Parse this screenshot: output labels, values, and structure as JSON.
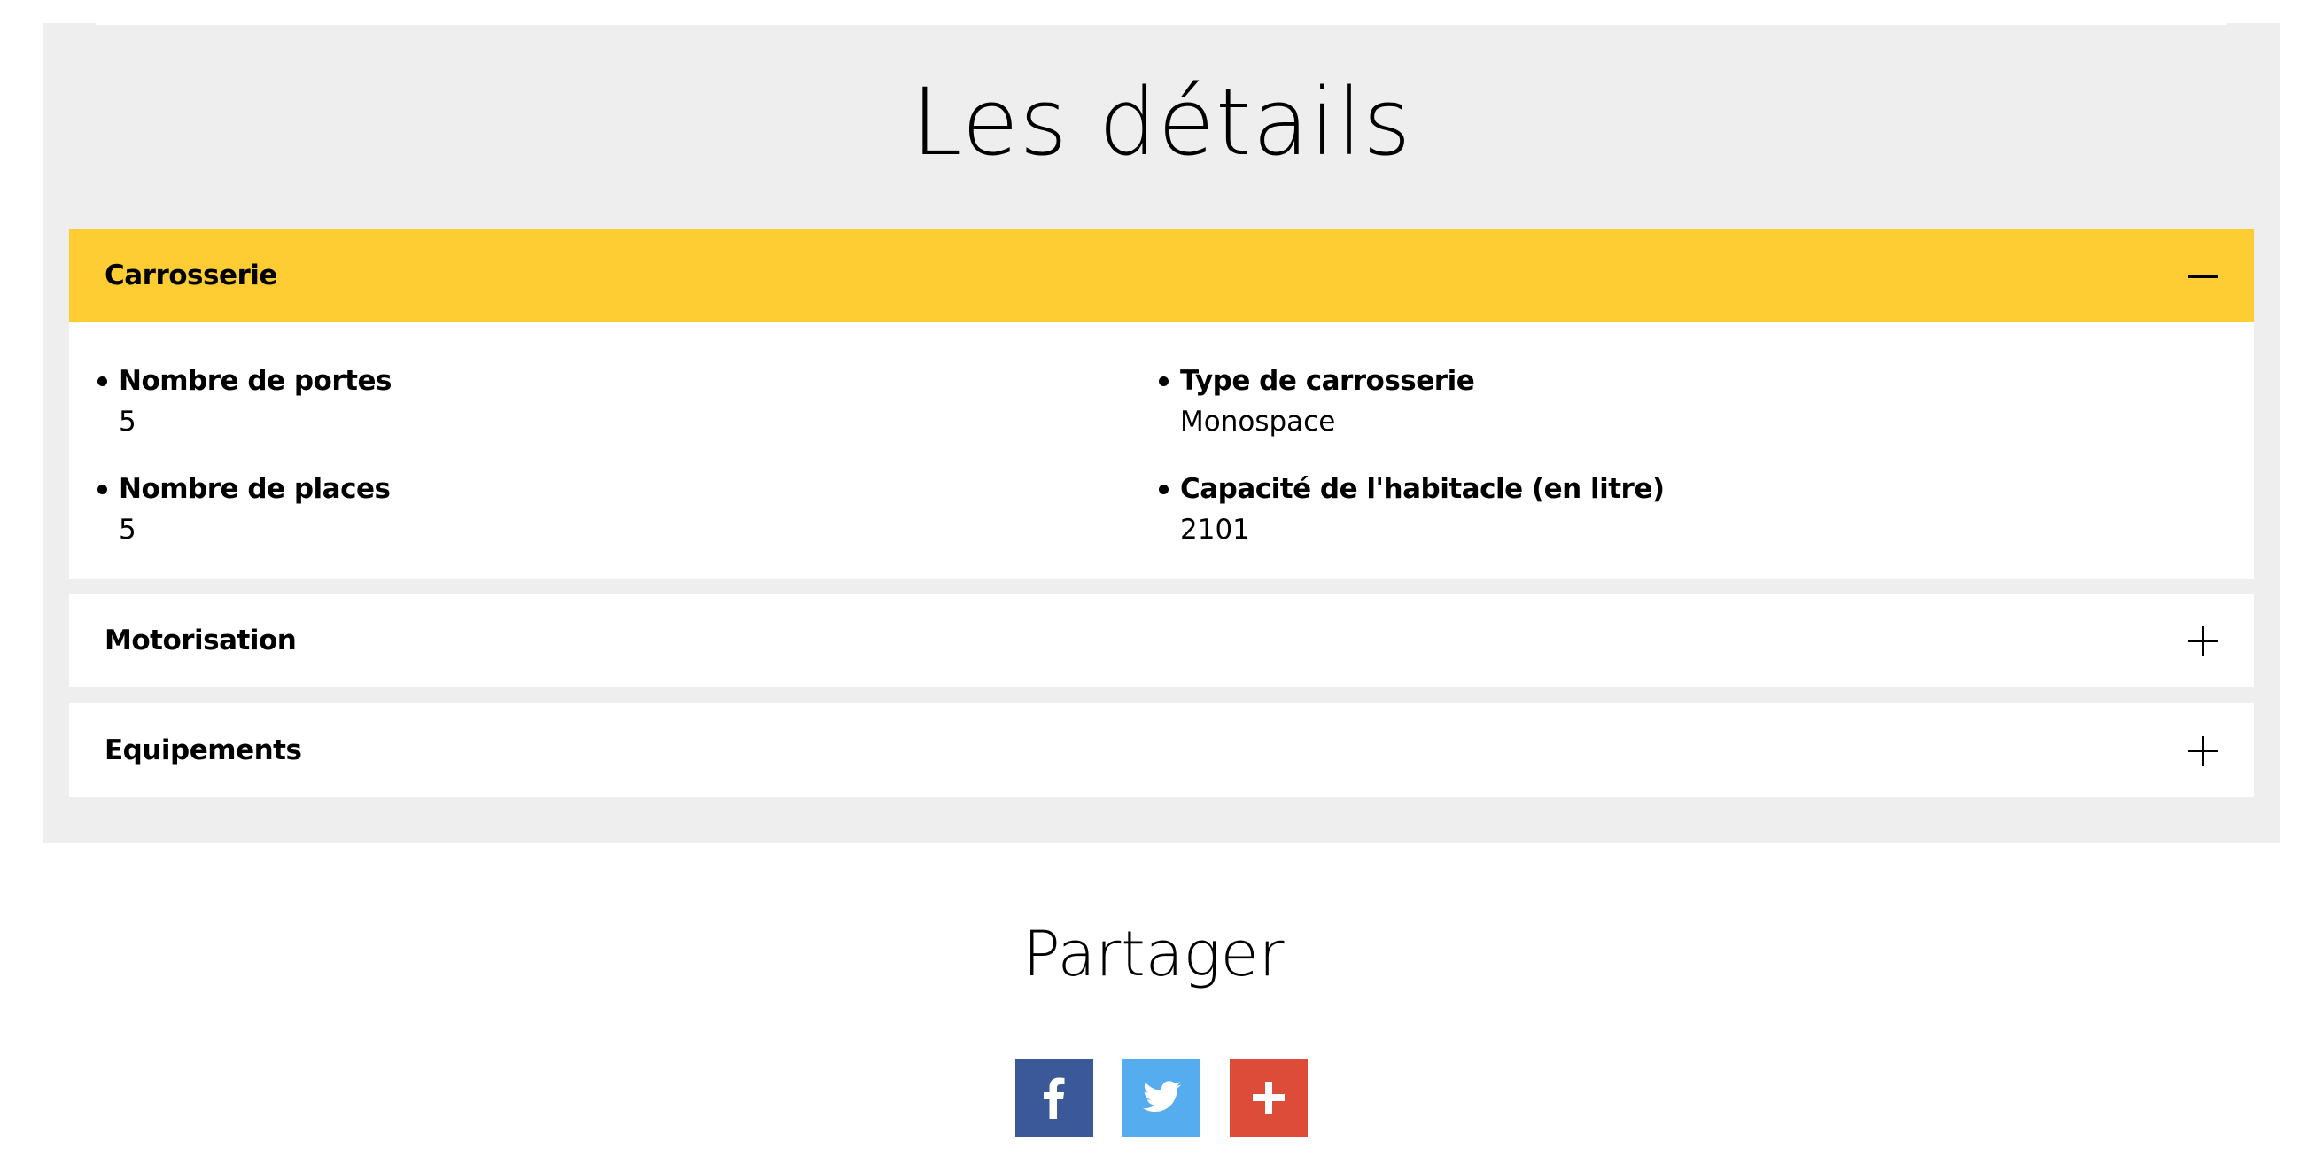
{
  "details": {
    "title": "Les détails",
    "panels": [
      {
        "title": "Carrosserie",
        "state": "open",
        "specs": [
          {
            "label": "Nombre de portes",
            "value": "5"
          },
          {
            "label": "Nombre de places",
            "value": "5"
          },
          {
            "label": "Type de carrosserie",
            "value": "Monospace"
          },
          {
            "label": "Capacité de l'habitacle (en litre)",
            "value": "2101"
          }
        ]
      },
      {
        "title": "Motorisation",
        "state": "collapsed"
      },
      {
        "title": "Equipements",
        "state": "collapsed"
      }
    ]
  },
  "share": {
    "title": "Partager",
    "buttons": [
      {
        "icon": "facebook-icon",
        "color": "#3b5998"
      },
      {
        "icon": "twitter-icon",
        "color": "#55acee"
      },
      {
        "icon": "plus-icon",
        "color": "#dd4b39"
      }
    ]
  },
  "colors": {
    "accent": "#fecc33",
    "section_bg": "#eeeeee"
  }
}
